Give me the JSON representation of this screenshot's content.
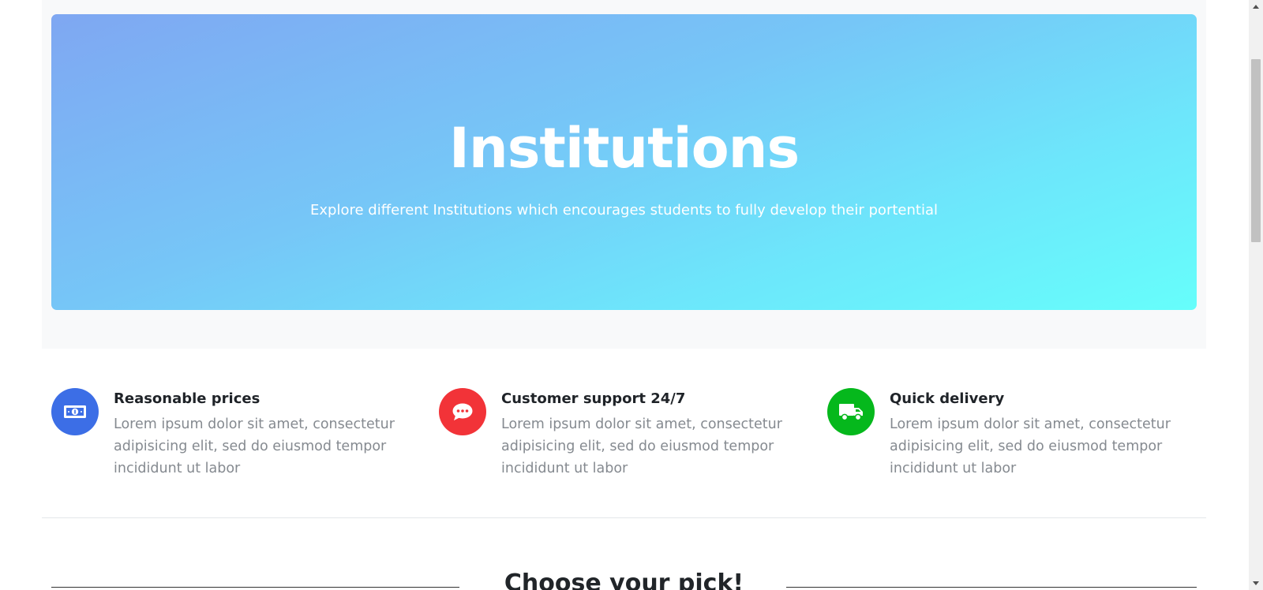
{
  "hero": {
    "title": "Institutions",
    "subtitle": "Explore different Institutions which encourages students to fully develop their portential",
    "gradient_start": "#7fa7f2",
    "gradient_end": "#66fefb"
  },
  "features": [
    {
      "icon": "money-bill-icon",
      "icon_color": "#3c6ee6",
      "title": "Reasonable prices",
      "text": "Lorem ipsum dolor sit amet, consectetur adipisicing elit, sed do eiusmod tempor incididunt ut labor"
    },
    {
      "icon": "chat-bubble-icon",
      "icon_color": "#f23338",
      "title": "Customer support 24/7",
      "text": "Lorem ipsum dolor sit amet, consectetur adipisicing elit, sed do eiusmod tempor incididunt ut labor"
    },
    {
      "icon": "truck-icon",
      "icon_color": "#05b81c",
      "title": "Quick delivery",
      "text": "Lorem ipsum dolor sit amet, consectetur adipisicing elit, sed do eiusmod tempor incididunt ut labor"
    }
  ],
  "pick_section": {
    "title": "Choose your pick!"
  },
  "scrollbar": {
    "scroll_position": 0.1
  }
}
